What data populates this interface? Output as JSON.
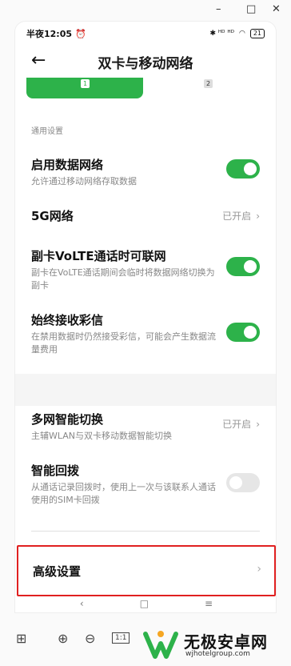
{
  "window": {
    "minimize": "–",
    "maximize": "□",
    "close": "✕"
  },
  "status": {
    "time": "半夜12:05",
    "alarm_icon": "alarm-icon",
    "right_text": "✱ ᴴᴰ ᴴᴰ",
    "battery": "21"
  },
  "header": {
    "back": "←",
    "title": "双卡与移动网络"
  },
  "sim_tabs": {
    "sim1": "1",
    "sim2": "2"
  },
  "section_label": "通用设置",
  "settings": [
    {
      "title": "启用数据网络",
      "subtitle": "允许通过移动网络存取数据",
      "toggle": true
    },
    {
      "title": "5G网络",
      "value": "已开启",
      "chevron": "›"
    },
    {
      "title": "副卡VoLTE通话时可联网",
      "subtitle": "副卡在VoLTE通话期间会临时将数据网络切换为副卡",
      "toggle": true
    },
    {
      "title": "始终接收彩信",
      "subtitle": "在禁用数据时仍然接受彩信，可能会产生数据流量费用",
      "toggle": true
    },
    {
      "title": "多网智能切换",
      "subtitle": "主辅WLAN与双卡移动数据智能切换",
      "value": "已开启",
      "chevron": "›"
    },
    {
      "title": "智能回拨",
      "subtitle": "从通话记录回拨时，使用上一次与该联系人通话使用的SIM卡回拨",
      "toggle": false
    },
    {
      "title": "高级设置",
      "chevron": "›"
    }
  ],
  "nav": {
    "back": "‹",
    "home": "□",
    "menu": "≡"
  },
  "toolbar": {
    "grid": "⊞",
    "zoom_in": "⊕",
    "zoom_out": "⊖",
    "actual": "1:1",
    "fit": "⛶"
  },
  "watermark": {
    "name": "无极安卓网",
    "url": "wjhotelgroup.com"
  },
  "colors": {
    "accent": "#2db24a",
    "highlight": "#e02020"
  }
}
